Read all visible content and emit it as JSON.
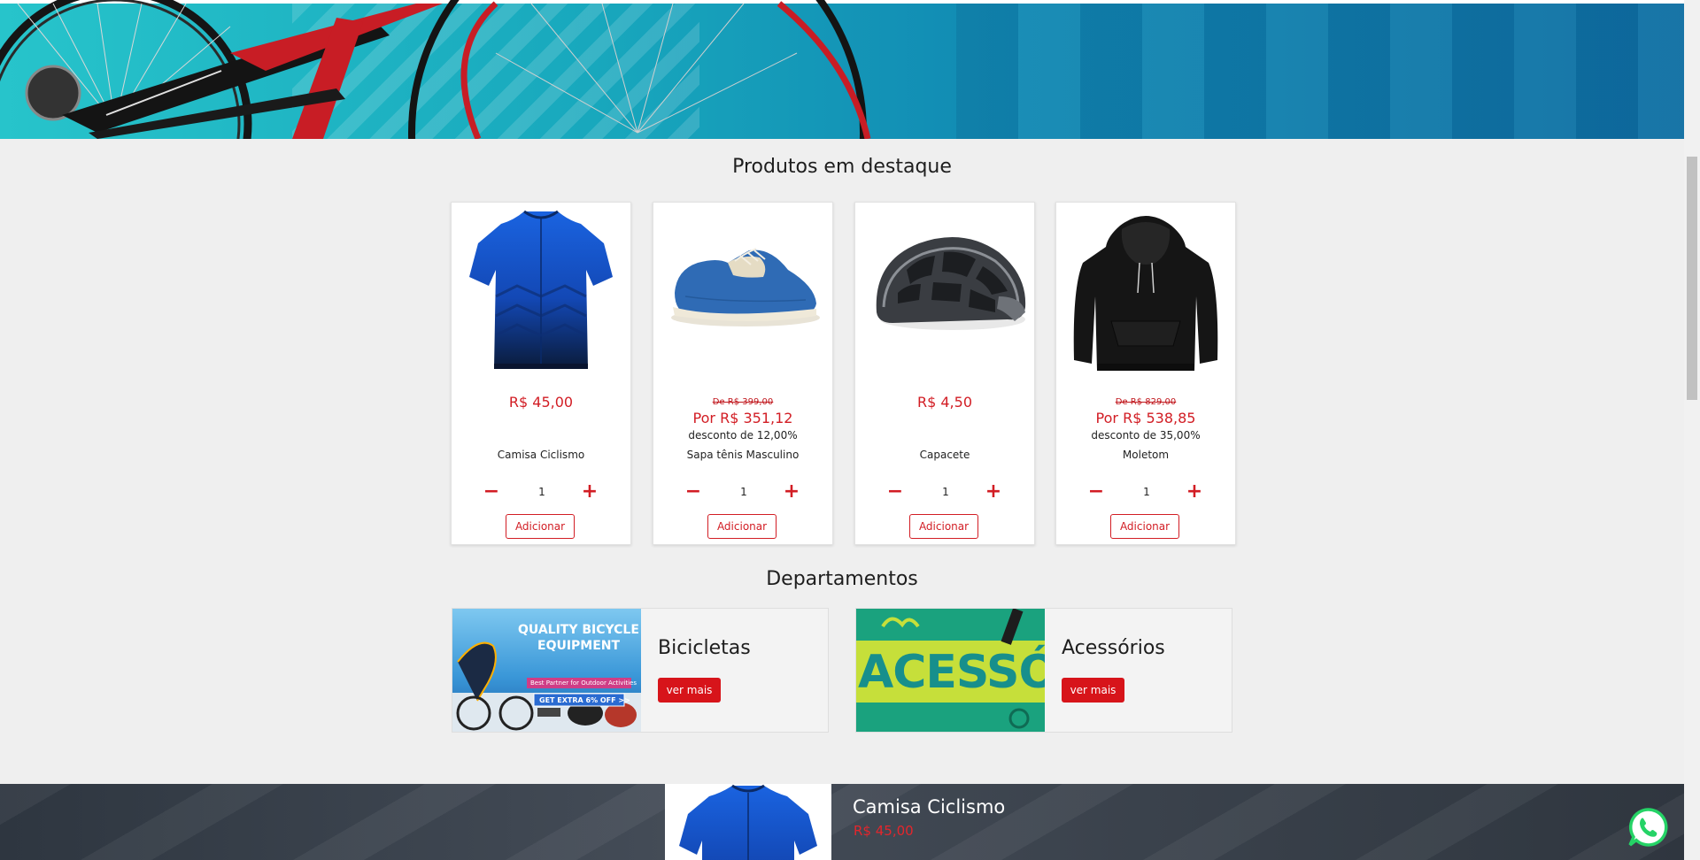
{
  "hero": {
    "alt": "bicycle-banner"
  },
  "featured_section": {
    "title": "Produtos em destaque"
  },
  "products": [
    {
      "name": "Camisa Ciclismo",
      "price": "R$ 45,00",
      "old_price": "",
      "discount": "",
      "quantity": "1",
      "add_label": "Adicionar",
      "icon": "jersey-image"
    },
    {
      "name": "Sapa tênis Masculino",
      "price": "Por R$ 351,12",
      "old_price": "De R$ 399,00",
      "discount": "desconto de 12,00%",
      "quantity": "1",
      "add_label": "Adicionar",
      "icon": "shoe-image"
    },
    {
      "name": "Capacete",
      "price": "R$ 4,50",
      "old_price": "",
      "discount": "",
      "quantity": "1",
      "add_label": "Adicionar",
      "icon": "helmet-image"
    },
    {
      "name": "Moletom",
      "price": "Por R$ 538,85",
      "old_price": "De R$ 829,00",
      "discount": "desconto de 35,00%",
      "quantity": "1",
      "add_label": "Adicionar",
      "icon": "hoodie-image"
    }
  ],
  "qty_controls": {
    "minus": "−",
    "plus": "+"
  },
  "departments_section": {
    "title": "Departamentos"
  },
  "departments": [
    {
      "name": "Bicicletas",
      "button": "ver mais",
      "banner_line1": "QUALITY BICYCLE",
      "banner_line2": "EQUIPMENT",
      "banner_line3": "Best Partner for Outdoor Activities",
      "banner_line4": "GET EXTRA 6% OFF >>"
    },
    {
      "name": "Acessórios",
      "button": "ver mais",
      "banner_text": "ACESSÓRI"
    }
  ],
  "featured_strip": {
    "name": "Camisa Ciclismo",
    "price": "R$ 45,00"
  },
  "colors": {
    "accent": "#d21d24",
    "button_red": "#d7141a",
    "hero_teal": "#27c4cb",
    "whatsapp": "#25d366"
  }
}
